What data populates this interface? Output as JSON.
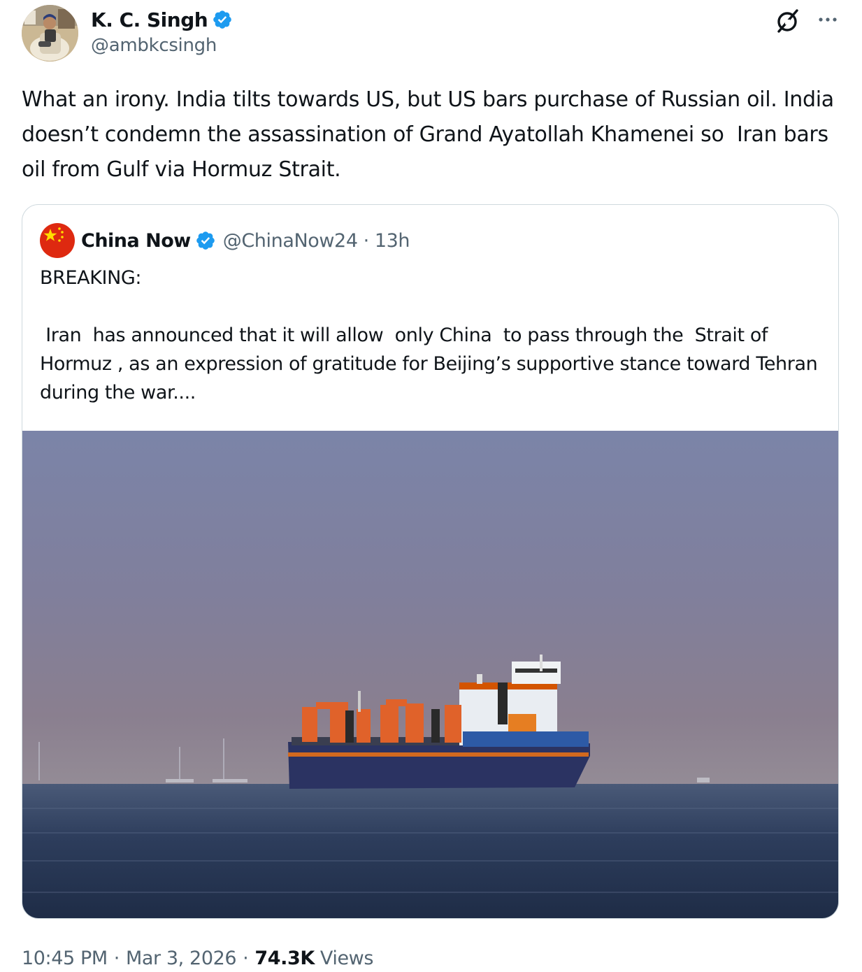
{
  "author": {
    "name": "K. C. Singh",
    "handle": "@ambkcsingh",
    "verified": true
  },
  "tweet": {
    "text": "What an irony. India tilts towards US, but US bars purchase of Russian oil. India doesn’t condemn the assassination of Grand Ayatollah Khamenei so  Iran bars oil from Gulf via Hormuz Strait."
  },
  "icons": {
    "header_right": [
      "grok-icon",
      "more-icon"
    ],
    "badge": "verified-badge-icon",
    "badge_color": "#1d9bf0"
  },
  "quote": {
    "name": "China Now",
    "handle": "@ChinaNow24",
    "dot": "·",
    "time": "13h",
    "verified": true,
    "text": "BREAKING:\n\n Iran  has announced that it will allow  only China  to pass through the  Strait of Hormuz , as an expression of gratitude for Beijing’s supportive stance toward Tehran during the war...."
  },
  "footer": {
    "time": "10:45 PM",
    "sep1": "·",
    "date": "Mar 3, 2026",
    "sep2": "·",
    "views_count": "74.3K",
    "views_label": "Views"
  },
  "colors": {
    "text_primary": "#0f1419",
    "text_secondary": "#536471",
    "border": "#cfd9de",
    "verified_blue": "#1d9bf0"
  }
}
